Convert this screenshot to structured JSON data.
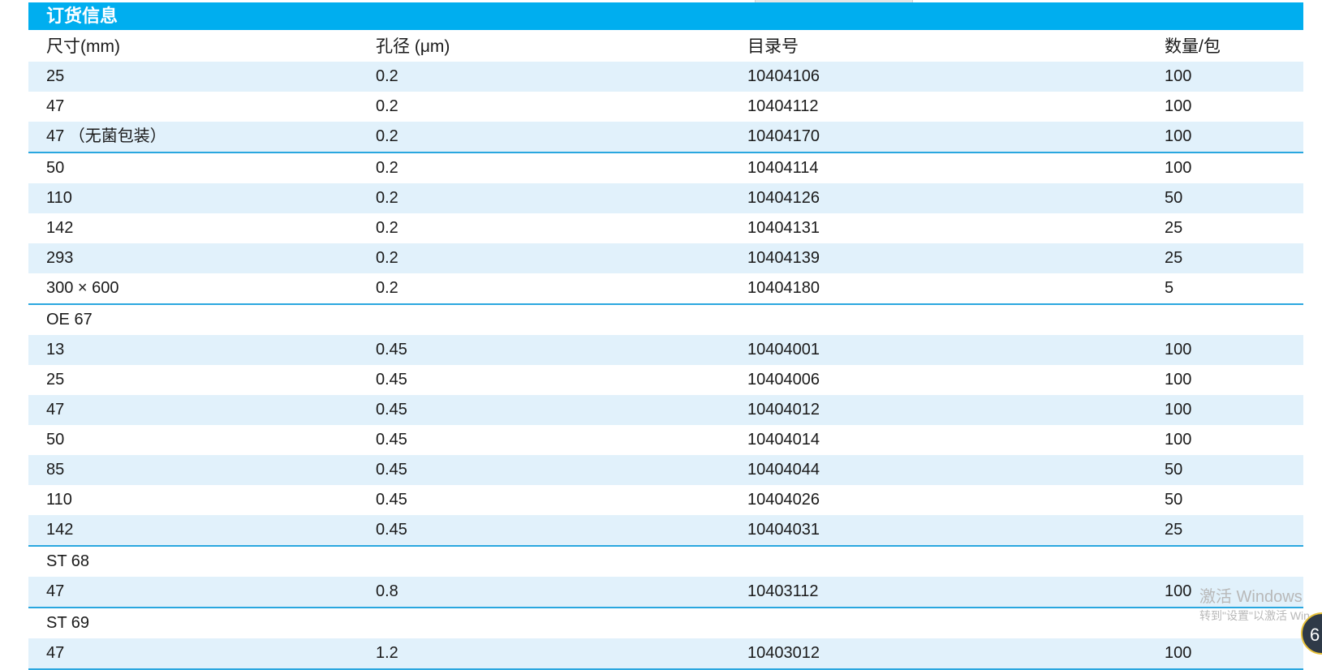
{
  "title": "订货信息",
  "columns": [
    "尺寸(mm)",
    "孔径 (μm)",
    "目录号",
    "数量/包"
  ],
  "rows": [
    {
      "size": "25",
      "pore": "0.2",
      "catalog": "10404106",
      "qty": "100"
    },
    {
      "size": "47",
      "pore": "0.2",
      "catalog": "10404112",
      "qty": "100"
    },
    {
      "size": "47 （无菌包装）",
      "pore": "0.2",
      "catalog": "10404170",
      "qty": "100"
    },
    {
      "size": "50",
      "pore": "0.2",
      "catalog": "10404114",
      "qty": "100"
    },
    {
      "size": "110",
      "pore": "0.2",
      "catalog": "10404126",
      "qty": "50"
    },
    {
      "size": "142",
      "pore": "0.2",
      "catalog": "10404131",
      "qty": "25"
    },
    {
      "size": "293",
      "pore": "0.2",
      "catalog": "10404139",
      "qty": "25"
    },
    {
      "size": "300 × 600",
      "pore": "0.2",
      "catalog": "10404180",
      "qty": "5"
    },
    {
      "group": "OE 67"
    },
    {
      "size": "13",
      "pore": "0.45",
      "catalog": "10404001",
      "qty": "100"
    },
    {
      "size": "25",
      "pore": "0.45",
      "catalog": "10404006",
      "qty": "100"
    },
    {
      "size": "47",
      "pore": "0.45",
      "catalog": "10404012",
      "qty": "100"
    },
    {
      "size": "50",
      "pore": "0.45",
      "catalog": "10404014",
      "qty": "100"
    },
    {
      "size": "85",
      "pore": "0.45",
      "catalog": "10404044",
      "qty": "50"
    },
    {
      "size": "110",
      "pore": "0.45",
      "catalog": "10404026",
      "qty": "50"
    },
    {
      "size": "142",
      "pore": "0.45",
      "catalog": "10404031",
      "qty": "25"
    },
    {
      "group": "ST 68"
    },
    {
      "size": "47",
      "pore": "0.8",
      "catalog": "10403112",
      "qty": "100"
    },
    {
      "group": "ST 69"
    },
    {
      "size": "47",
      "pore": "1.2",
      "catalog": "10403012",
      "qty": "100"
    }
  ],
  "watermark": {
    "line1": "激活 Windows",
    "line2": "转到\"设置\"以激活 Win"
  },
  "badge": "6",
  "colors": {
    "title_bar": "#00aeef",
    "row_shade": "#e1f1fb",
    "rule": "#2aa7df"
  }
}
